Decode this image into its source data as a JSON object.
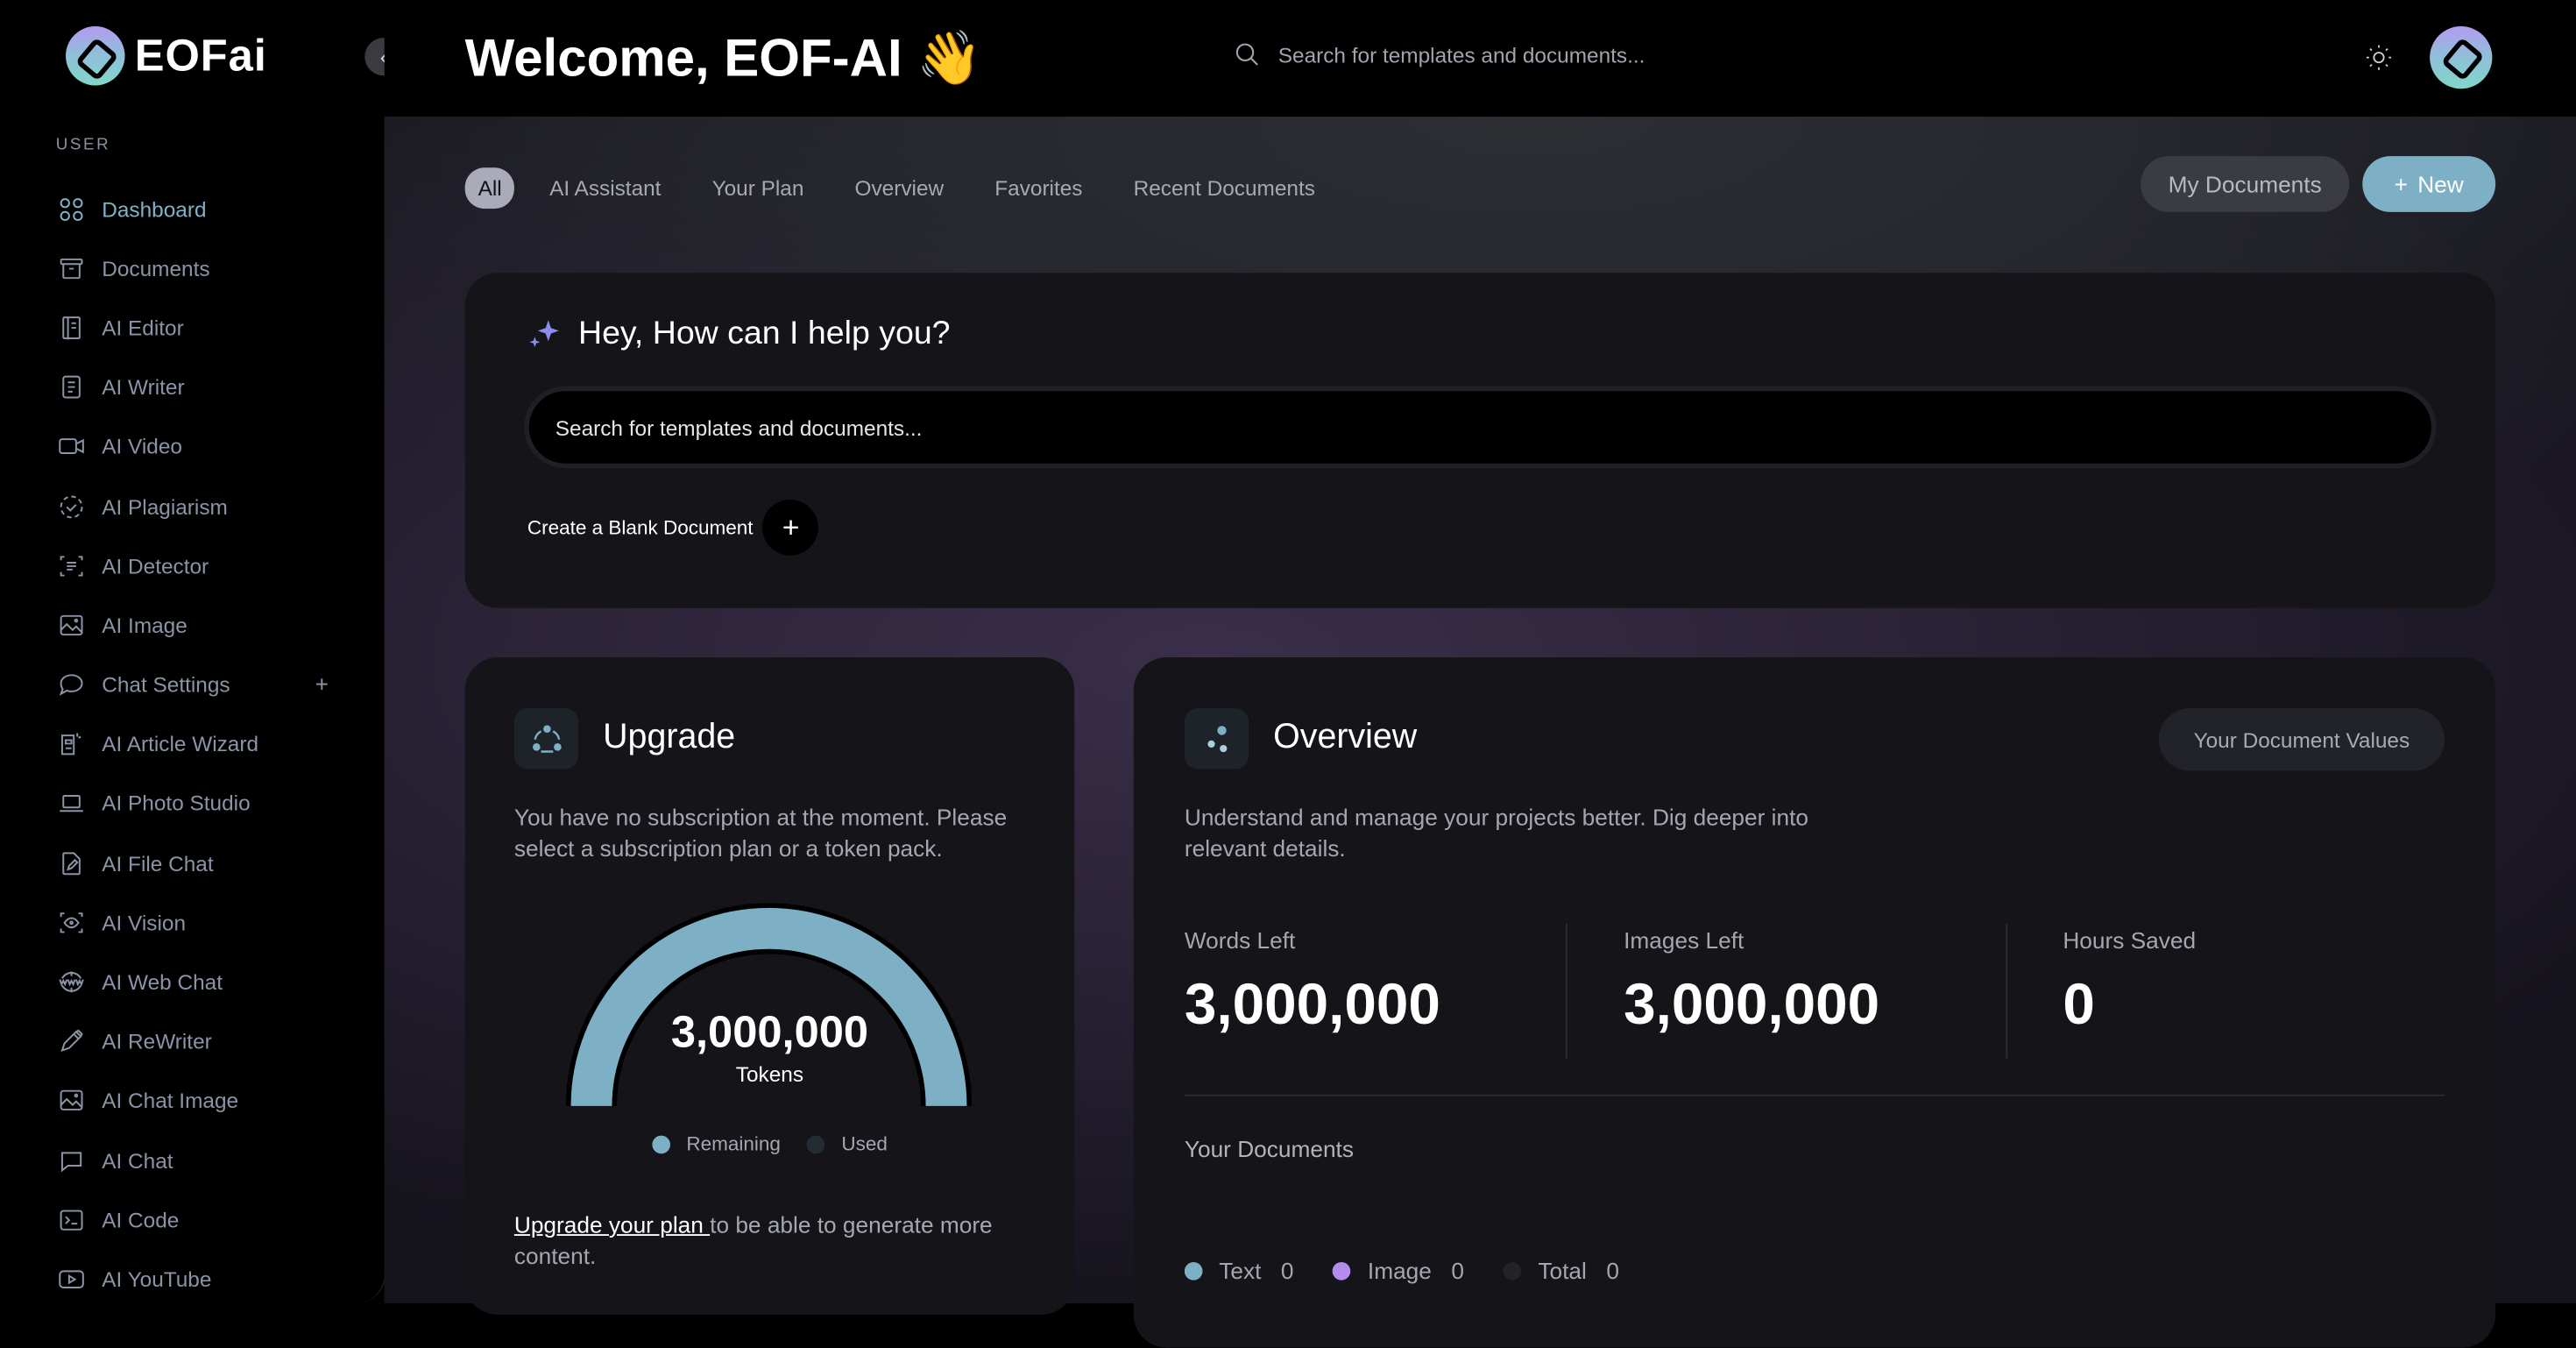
{
  "app": {
    "logo_text": "EOFai",
    "collapse_icon": "chevron-left-icon"
  },
  "sidebar": {
    "section_label": "USER",
    "items": [
      {
        "label": "Dashboard",
        "icon": "dashboard-icon",
        "active": true
      },
      {
        "label": "Documents",
        "icon": "archive-box-icon"
      },
      {
        "label": "AI Editor",
        "icon": "notebook-icon"
      },
      {
        "label": "AI Writer",
        "icon": "document-text-icon"
      },
      {
        "label": "AI Video",
        "icon": "video-camera-icon"
      },
      {
        "label": "AI Plagiarism",
        "icon": "dashed-check-circle-icon"
      },
      {
        "label": "AI Detector",
        "icon": "scan-text-icon"
      },
      {
        "label": "AI Image",
        "icon": "image-icon"
      },
      {
        "label": "Chat Settings",
        "icon": "chat-bubble-icon",
        "expandable": true
      },
      {
        "label": "AI Article Wizard",
        "icon": "article-wizard-icon"
      },
      {
        "label": "AI Photo Studio",
        "icon": "laptop-icon"
      },
      {
        "label": "AI File Chat",
        "icon": "file-edit-icon"
      },
      {
        "label": "AI Vision",
        "icon": "scan-eye-icon"
      },
      {
        "label": "AI Web Chat",
        "icon": "www-globe-icon"
      },
      {
        "label": "AI ReWriter",
        "icon": "pencil-icon"
      },
      {
        "label": "AI Chat Image",
        "icon": "image-icon"
      },
      {
        "label": "AI Chat",
        "icon": "chat-dots-icon"
      },
      {
        "label": "AI Code",
        "icon": "terminal-icon"
      },
      {
        "label": "AI YouTube",
        "icon": "play-box-icon"
      }
    ],
    "expand_symbol": "+"
  },
  "header": {
    "welcome": "Welcome, EOF-AI 👋",
    "search_placeholder": "Search for templates and documents...",
    "theme_icon": "sun-icon"
  },
  "tabs": [
    {
      "label": "All",
      "active": true
    },
    {
      "label": "AI Assistant"
    },
    {
      "label": "Your Plan"
    },
    {
      "label": "Overview"
    },
    {
      "label": "Favorites"
    },
    {
      "label": "Recent Documents"
    }
  ],
  "actions": {
    "my_documents": "My Documents",
    "new_label": "New",
    "new_symbol": "+"
  },
  "assistant": {
    "title": "Hey, How can I help you?",
    "search_placeholder": "Search for templates and documents...",
    "blank_doc_label": "Create a Blank Document",
    "blank_doc_symbol": "+"
  },
  "upgrade": {
    "title": "Upgrade",
    "description": "You have no subscription at the moment. Please select a subscription plan or a token pack.",
    "tokens_value": "3,000,000",
    "tokens_label": "Tokens",
    "remaining_fraction": 1.0,
    "legend": [
      {
        "label": "Remaining",
        "color": "#7eb0c5"
      },
      {
        "label": "Used",
        "color": "#232c33"
      }
    ],
    "footer_link": "Upgrade your plan ",
    "footer_text": "to be able to generate more content."
  },
  "overview": {
    "title": "Overview",
    "values_button": "Your Document Values",
    "description": "Understand and manage your projects better. Dig deeper into relevant details.",
    "stats": [
      {
        "label": "Words Left",
        "value": "3,000,000"
      },
      {
        "label": "Images Left",
        "value": "3,000,000"
      },
      {
        "label": "Hours Saved",
        "value": "0"
      }
    ],
    "documents_title": "Your Documents",
    "document_legend": [
      {
        "label": "Text",
        "value": "0",
        "color": "#7eb0c5"
      },
      {
        "label": "Image",
        "value": "0",
        "color": "#b48cf0"
      },
      {
        "label": "Total",
        "value": "0",
        "color": "#222328"
      }
    ]
  },
  "colors": {
    "accent": "#7eb0c5",
    "sparkle": "#8c8cf0"
  }
}
